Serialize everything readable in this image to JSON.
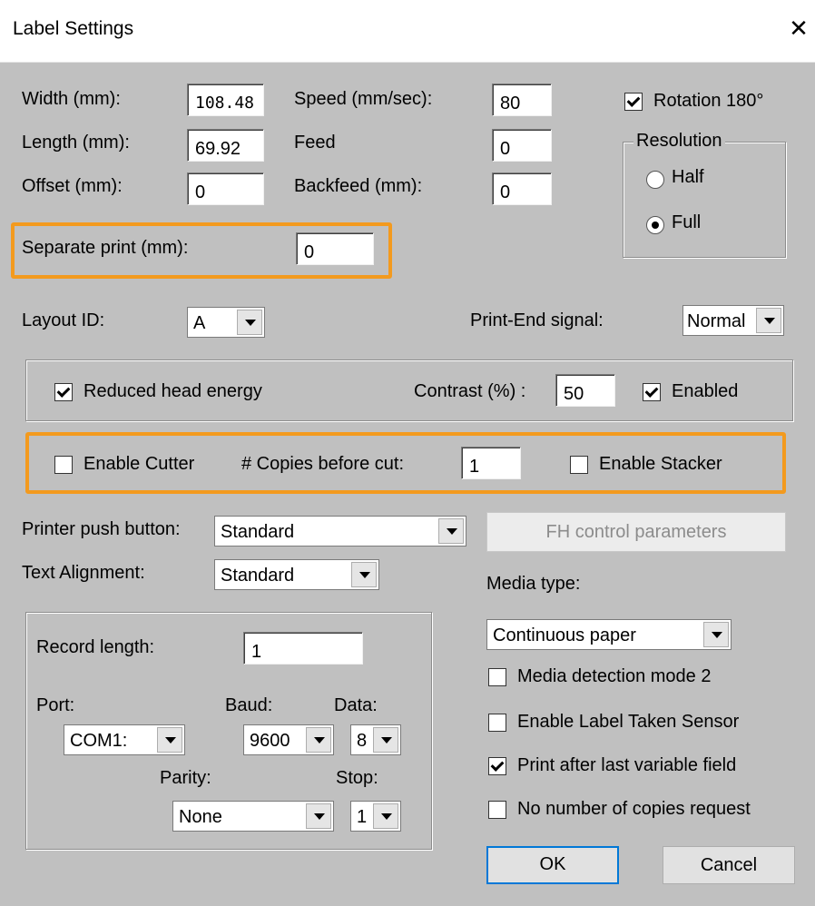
{
  "window": {
    "title": "Label Settings"
  },
  "fields": {
    "width_label": "Width (mm):",
    "width_value": "108.48",
    "length_label": "Length (mm):",
    "length_value": "69.92",
    "offset_label": "Offset (mm):",
    "offset_value": "0",
    "speed_label": "Speed (mm/sec):",
    "speed_value": "80",
    "feed_label": "Feed",
    "feed_value": "0",
    "backfeed_label": "Backfeed (mm):",
    "backfeed_value": "0",
    "separate_label": "Separate print (mm):",
    "separate_value": "0"
  },
  "rotation": {
    "label": "Rotation 180°",
    "checked": true
  },
  "resolution": {
    "label": "Resolution",
    "half": "Half",
    "full": "Full",
    "selected": "Full"
  },
  "layout": {
    "label": "Layout ID:",
    "value": "A"
  },
  "print_end": {
    "label": "Print-End signal:",
    "value": "Normal"
  },
  "energy": {
    "reduced_label": "Reduced head energy",
    "reduced_checked": true,
    "contrast_label": "Contrast (%) :",
    "contrast_value": "50",
    "enabled_label": "Enabled",
    "enabled_checked": true
  },
  "cutter": {
    "enable_label": "Enable Cutter",
    "enable_checked": false,
    "copies_label": "# Copies before cut:",
    "copies_value": "1",
    "stacker_label": "Enable Stacker",
    "stacker_checked": false
  },
  "push_button": {
    "label": "Printer push button:",
    "value": "Standard"
  },
  "fh_button": "FH control parameters",
  "text_alignment": {
    "label": "Text Alignment:",
    "value": "Standard"
  },
  "media": {
    "label": "Media type:",
    "value": "Continuous paper",
    "options": [
      {
        "label": "Media detection mode 2",
        "checked": false
      },
      {
        "label": "Enable Label Taken Sensor",
        "checked": false
      },
      {
        "label": "Print after last variable field",
        "checked": true
      },
      {
        "label": "No number of copies request",
        "checked": false
      }
    ]
  },
  "serial": {
    "record_label": "Record length:",
    "record_value": "1",
    "port_label": "Port:",
    "port_value": "COM1:",
    "baud_label": "Baud:",
    "baud_value": "9600",
    "data_label": "Data:",
    "data_value": "8",
    "parity_label": "Parity:",
    "parity_value": "None",
    "stop_label": "Stop:",
    "stop_value": "1"
  },
  "buttons": {
    "ok": "OK",
    "cancel": "Cancel"
  },
  "colors": {
    "highlight": "#f39a1e",
    "background": "#c0c0c0"
  }
}
